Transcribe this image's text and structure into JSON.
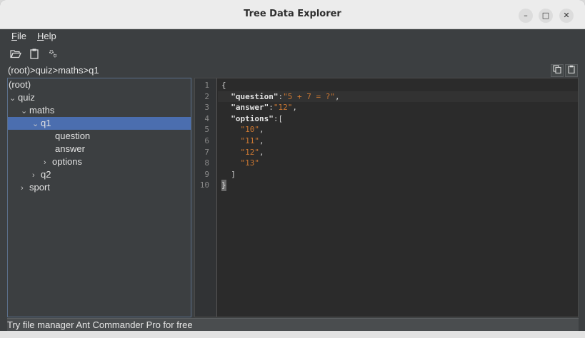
{
  "window": {
    "title": "Tree Data Explorer"
  },
  "menu": [
    {
      "first": "F",
      "rest": "ile"
    },
    {
      "first": "H",
      "rest": "elp"
    }
  ],
  "toolbar": {
    "open_icon": "folder-open-icon",
    "clipboard_icon": "clipboard-icon",
    "settings_icon": "settings-icon"
  },
  "breadcrumb": "(root)>quiz>maths>q1",
  "tree": {
    "nodes": [
      {
        "label": "(root)",
        "chevron": "",
        "level": 0
      },
      {
        "label": "quiz",
        "chevron": "⌄",
        "level": 0
      },
      {
        "label": "maths",
        "chevron": "⌄",
        "level": 1
      },
      {
        "label": "q1",
        "chevron": "⌄",
        "level": 2,
        "selected": true
      },
      {
        "label": "question",
        "chevron": "",
        "level": 4
      },
      {
        "label": "answer",
        "chevron": "",
        "level": 4
      },
      {
        "label": "options",
        "chevron": "›",
        "level": 3
      },
      {
        "label": "q2",
        "chevron": "›",
        "level": 2
      },
      {
        "label": "sport",
        "chevron": "›",
        "level": 1
      }
    ]
  },
  "editor": {
    "line_numbers": [
      "1",
      "2",
      "3",
      "4",
      "5",
      "6",
      "7",
      "8",
      "9",
      "10"
    ],
    "lines": [
      [
        {
          "t": "{",
          "c": "p"
        }
      ],
      [
        {
          "t": "  ",
          "c": "p"
        },
        {
          "t": "\"question\"",
          "c": "k"
        },
        {
          "t": ":",
          "c": "p"
        },
        {
          "t": "\"5 + 7 = ?\"",
          "c": "s"
        },
        {
          "t": ",",
          "c": "p"
        }
      ],
      [
        {
          "t": "  ",
          "c": "p"
        },
        {
          "t": "\"answer\"",
          "c": "k"
        },
        {
          "t": ":",
          "c": "p"
        },
        {
          "t": "\"12\"",
          "c": "s"
        },
        {
          "t": ",",
          "c": "p"
        }
      ],
      [
        {
          "t": "  ",
          "c": "p"
        },
        {
          "t": "\"options\"",
          "c": "k"
        },
        {
          "t": ":[",
          "c": "p"
        }
      ],
      [
        {
          "t": "    ",
          "c": "p"
        },
        {
          "t": "\"10\"",
          "c": "s"
        },
        {
          "t": ",",
          "c": "p"
        }
      ],
      [
        {
          "t": "    ",
          "c": "p"
        },
        {
          "t": "\"11\"",
          "c": "s"
        },
        {
          "t": ",",
          "c": "p"
        }
      ],
      [
        {
          "t": "    ",
          "c": "p"
        },
        {
          "t": "\"12\"",
          "c": "s"
        },
        {
          "t": ",",
          "c": "p"
        }
      ],
      [
        {
          "t": "    ",
          "c": "p"
        },
        {
          "t": "\"13\"",
          "c": "s"
        }
      ],
      [
        {
          "t": "  ]",
          "c": "p"
        }
      ],
      [
        {
          "t": "}",
          "c": "caret"
        }
      ]
    ]
  },
  "status": {
    "message": "Try file manager Ant Commander Pro for free"
  },
  "colors": {
    "selection": "#4b6eaf",
    "string": "#cc7832",
    "background": "#3c3f41",
    "editor_bg": "#2b2b2b"
  }
}
